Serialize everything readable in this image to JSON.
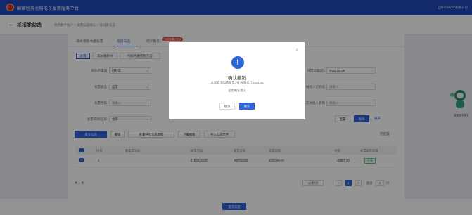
{
  "header": {
    "title": "国家税务总局电子发票服务平台",
    "user": "上海市XXXX有限公司"
  },
  "page": {
    "back": "←",
    "title": "抵扣类勾选",
    "breadcrumb": "税务数字账户 > 发票勾选确认 > 抵扣类勾选"
  },
  "tabs": [
    {
      "label": "海关缴款书类发票"
    },
    {
      "label": "抵扣勾选"
    },
    {
      "label": "统计确认"
    },
    {
      "badge": "当前属期已统计"
    }
  ],
  "segments": [
    "发票",
    "海关缴款书",
    "代扣代缴完税凭证"
  ],
  "filters": {
    "tax_status": {
      "label": "税款所属期",
      "value": "已勾选"
    },
    "invoice_status": {
      "label": "发票状态",
      "value": "正常"
    },
    "invoice_code": {
      "label": "发票代码",
      "placeholder": "请输入"
    },
    "source": {
      "label": "发票来源/选择",
      "value": "全部"
    },
    "invoice_date": {
      "label": "开票日期(起)",
      "value": "2022-05-28"
    },
    "seller_taxno": {
      "label": "销售方纳税人识别号",
      "placeholder": "请输入"
    },
    "seller_name": {
      "label": "销售方纳税人名称",
      "placeholder": "请输入"
    }
  },
  "actions": {
    "reset": "重置",
    "query": "查询",
    "expand": "展开",
    "confirm_deduct": "提交勾选",
    "undo": "撤销",
    "export_a": "批量导出勾选数据",
    "download": "下载模板",
    "import": "导入勾选文件",
    "settings": "列配置"
  },
  "table": {
    "headers": [
      "序号",
      "数电票号码",
      "发票代码",
      "发票号码",
      "开票日期",
      "金额",
      "发票风险等级"
    ],
    "rows": [
      {
        "index": "1",
        "code": "0100214130",
        "number": "59752182",
        "date": "2022-06-07",
        "amount": "49907.40",
        "status": "正常"
      }
    ]
  },
  "pager": {
    "total": "共 1 条",
    "page_size": "10条/页",
    "prev": "<",
    "current": "1",
    "next": ">",
    "goto_label": "前往",
    "goto_value": "1",
    "goto_suffix": "页"
  },
  "bottom": {
    "submit": "提交勾选"
  },
  "modal": {
    "close": "×",
    "icon": "!",
    "title": "确认撤销",
    "message": "本次取消勾选发票1份,税额合计2343.45",
    "question": "是否确认提交",
    "cancel": "取消",
    "ok": "确认"
  },
  "mascot": {
    "caption": "智能税务助手"
  },
  "colors": {
    "brand": "#1f47b8",
    "accent": "#2d64d6",
    "danger": "#e5453d",
    "success": "#2e9a54"
  }
}
